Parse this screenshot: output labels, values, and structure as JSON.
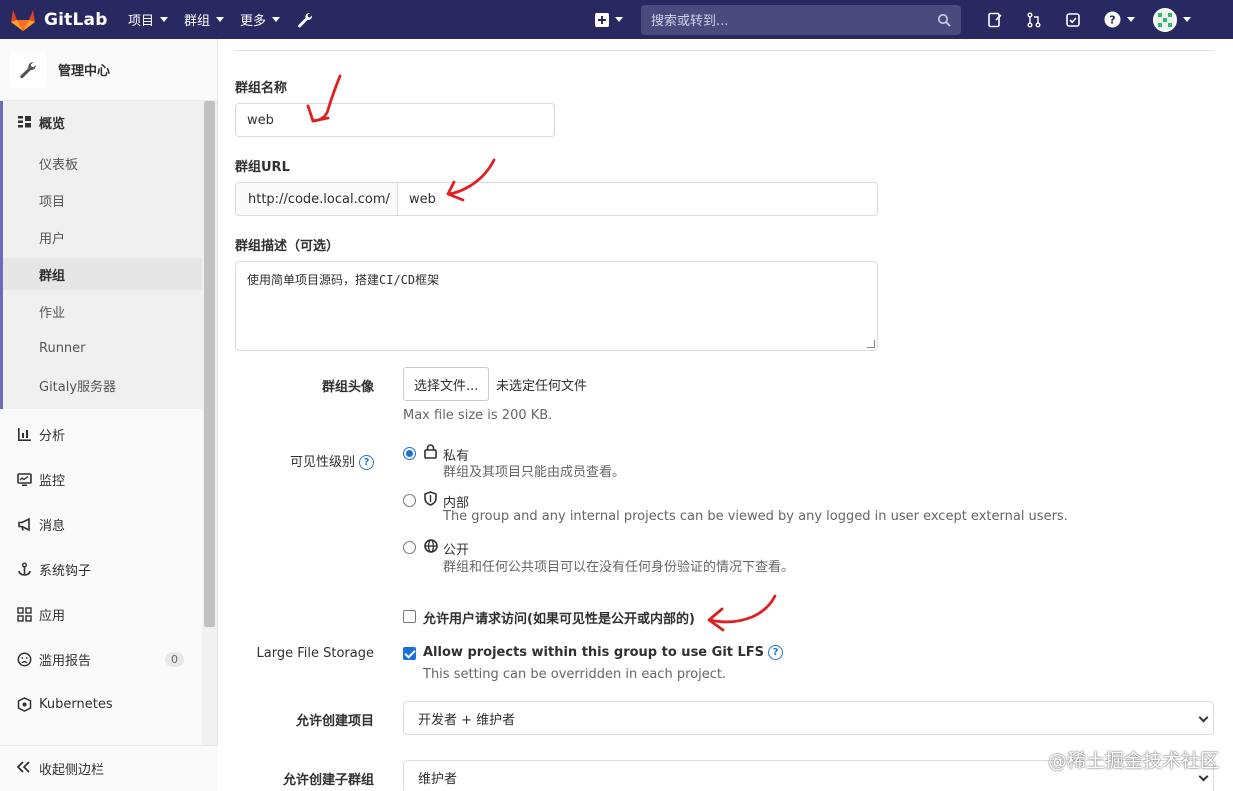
{
  "topnav": {
    "brand": "GitLab",
    "menu": [
      {
        "label": "项目"
      },
      {
        "label": "群组"
      },
      {
        "label": "更多"
      }
    ],
    "search_placeholder": "搜索或转到..."
  },
  "sidebar": {
    "title": "管理中心",
    "overview_label": "概览",
    "sub_items": [
      "仪表板",
      "项目",
      "用户",
      "群组",
      "作业",
      "Runner",
      "Gitaly服务器"
    ],
    "active_sub": "群组",
    "items": [
      {
        "label": "分析",
        "icon": "chart-icon"
      },
      {
        "label": "监控",
        "icon": "monitor-icon"
      },
      {
        "label": "消息",
        "icon": "megaphone-icon"
      },
      {
        "label": "系统钩子",
        "icon": "hook-icon"
      },
      {
        "label": "应用",
        "icon": "grid-icon"
      },
      {
        "label": "滥用报告",
        "icon": "abuse-icon",
        "badge": "0"
      },
      {
        "label": "Kubernetes",
        "icon": "kubernetes-icon"
      }
    ],
    "collapse_label": "收起侧边栏"
  },
  "form": {
    "group_name_label": "群组名称",
    "group_name_value": "web",
    "group_url_label": "群组URL",
    "group_url_prefix": "http://code.local.com/",
    "group_url_value": "web",
    "description_label": "群组描述（可选）",
    "description_value": "使用简单项目源码，搭建CI/CD框架",
    "avatar_label": "群组头像",
    "choose_file_button": "选择文件...",
    "no_file_text": "未选定任何文件",
    "max_size_text": "Max file size is 200 KB.",
    "visibility_label": "可见性级别",
    "visibility_options": [
      {
        "title": "私有",
        "desc": "群组及其项目只能由成员查看。",
        "selected": true
      },
      {
        "title": "内部",
        "desc": "The group and any internal projects can be viewed by any logged in user except external users.",
        "selected": false
      },
      {
        "title": "公开",
        "desc": "群组和任何公共项目可以在没有任何身份验证的情况下查看。",
        "selected": false
      }
    ],
    "request_access_label": "允许用户请求访问(如果可见性是公开或内部的)",
    "request_access_checked": false,
    "lfs_label": "Large File Storage",
    "lfs_check_label": "Allow projects within this group to use Git LFS",
    "lfs_checked": true,
    "lfs_help": "This setting can be overridden in each project.",
    "create_project_label": "允许创建项目",
    "create_project_value": "开发者 + 维护者",
    "create_subgroup_label": "允许创建子群组",
    "create_subgroup_value": "维护者"
  },
  "watermark": "@稀土掘金技术社区",
  "colors": {
    "nav_bg": "#292961",
    "accent": "#1a6fe0",
    "annotation": "#e02020"
  }
}
